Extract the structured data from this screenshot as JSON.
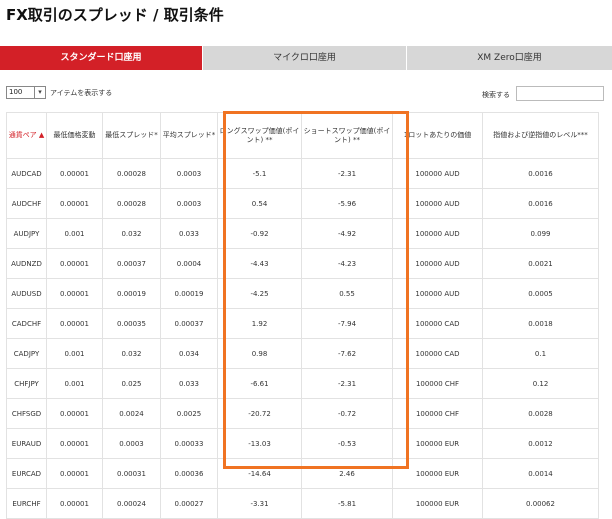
{
  "page": {
    "title": "FX取引のスプレッド / 取引条件"
  },
  "tabs": [
    {
      "label": "スタンダード口座用",
      "active": true
    },
    {
      "label": "マイクロ口座用",
      "active": false
    },
    {
      "label": "XM Zero口座用",
      "active": false
    }
  ],
  "controls": {
    "page_size": "100",
    "page_size_suffix": "アイテムを表示する",
    "search_label": "検索する",
    "search_value": ""
  },
  "table": {
    "columns": [
      "通貨ペア ▲",
      "最低価格変動",
      "最低スプレッド*",
      "平均スプレッド*",
      "ロングスワップ価値(ポイント) **",
      "ショートスワップ価値(ポイント) **",
      "1ロットあたりの価値",
      "指値および逆指値のレベル***"
    ],
    "rows": [
      [
        "AUDCAD",
        "0.00001",
        "0.00028",
        "0.0003",
        "-5.1",
        "-2.31",
        "100000 AUD",
        "0.0016"
      ],
      [
        "AUDCHF",
        "0.00001",
        "0.00028",
        "0.0003",
        "0.54",
        "-5.96",
        "100000 AUD",
        "0.0016"
      ],
      [
        "AUDJPY",
        "0.001",
        "0.032",
        "0.033",
        "-0.92",
        "-4.92",
        "100000 AUD",
        "0.099"
      ],
      [
        "AUDNZD",
        "0.00001",
        "0.00037",
        "0.0004",
        "-4.43",
        "-4.23",
        "100000 AUD",
        "0.0021"
      ],
      [
        "AUDUSD",
        "0.00001",
        "0.00019",
        "0.00019",
        "-4.25",
        "0.55",
        "100000 AUD",
        "0.0005"
      ],
      [
        "CADCHF",
        "0.00001",
        "0.00035",
        "0.00037",
        "1.92",
        "-7.94",
        "100000 CAD",
        "0.0018"
      ],
      [
        "CADJPY",
        "0.001",
        "0.032",
        "0.034",
        "0.98",
        "-7.62",
        "100000 CAD",
        "0.1"
      ],
      [
        "CHFJPY",
        "0.001",
        "0.025",
        "0.033",
        "-6.61",
        "-2.31",
        "100000 CHF",
        "0.12"
      ],
      [
        "CHFSGD",
        "0.00001",
        "0.0024",
        "0.0025",
        "-20.72",
        "-0.72",
        "100000 CHF",
        "0.0028"
      ],
      [
        "EURAUD",
        "0.00001",
        "0.0003",
        "0.00033",
        "-13.03",
        "-0.53",
        "100000 EUR",
        "0.0012"
      ],
      [
        "EURCAD",
        "0.00001",
        "0.00031",
        "0.00036",
        "-14.64",
        "2.46",
        "100000 EUR",
        "0.0014"
      ],
      [
        "EURCHF",
        "0.00001",
        "0.00024",
        "0.00027",
        "-3.31",
        "-5.81",
        "100000 EUR",
        "0.00062"
      ]
    ]
  },
  "colors": {
    "accent": "#d32027",
    "highlight": "#f07322"
  }
}
